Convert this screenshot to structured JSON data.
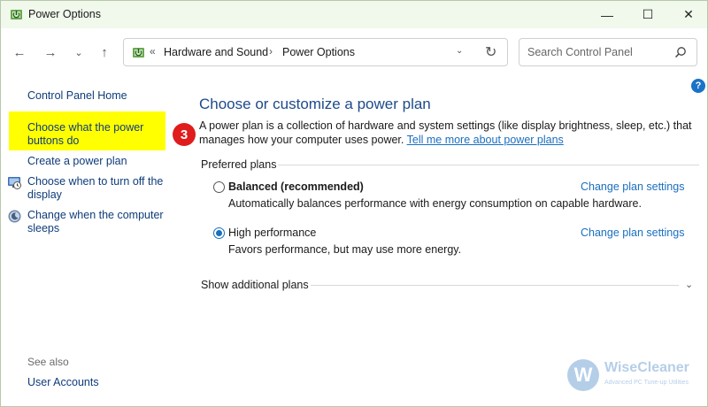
{
  "window": {
    "title": "Power Options",
    "min_glyph": "—",
    "max_glyph": "☐",
    "close_glyph": "✕"
  },
  "nav": {
    "back_glyph": "←",
    "forward_glyph": "→",
    "recent_glyph": "⌄",
    "up_glyph": "↑",
    "chevrons_glyph": "«",
    "breadcrumb": [
      "Hardware and Sound",
      "Power Options"
    ],
    "breadcrumb_sep": "›",
    "dropdown_glyph": "⌄",
    "refresh_glyph": "↻",
    "search_placeholder": "Search Control Panel"
  },
  "sidebar": {
    "home": "Control Panel Home",
    "power_buttons": "Choose what the power buttons do",
    "create_plan": "Create a power plan",
    "turn_off_display": "Choose when to turn off the display",
    "change_sleep": "Change when the computer sleeps",
    "see_also": "See also",
    "user_accounts": "User Accounts"
  },
  "main": {
    "help_glyph": "?",
    "title": "Choose or customize a power plan",
    "step_number": "3",
    "description": "A power plan is a collection of hardware and system settings (like display brightness, sleep, etc.) that manages how your computer uses power.",
    "learn_more": "Tell me more about power plans",
    "preferred_label": "Preferred plans",
    "plans": [
      {
        "name": "Balanced (recommended)",
        "description": "Automatically balances performance with energy consumption on capable hardware.",
        "settings_link": "Change plan settings",
        "selected": false
      },
      {
        "name": "High performance",
        "description": "Favors performance, but may use more energy.",
        "settings_link": "Change plan settings",
        "selected": true
      }
    ],
    "show_additional": "Show additional plans",
    "expand_glyph": "⌄"
  },
  "watermark": {
    "logo_letter": "W",
    "name": "WiseCleaner",
    "tagline": "Advanced PC Tune-up Utilities"
  },
  "colors": {
    "link": "#1a6fc0",
    "sidebar_link": "#0f3c7a",
    "title": "#1e4a8a",
    "highlight": "#ffff00",
    "step_badge": "#e01c1c",
    "titlebar_bg": "#f1f8ec"
  }
}
